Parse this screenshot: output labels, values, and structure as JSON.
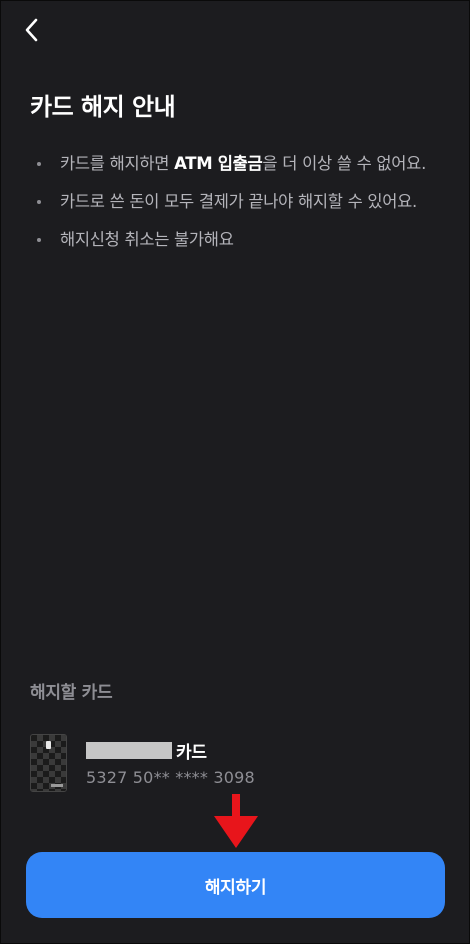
{
  "nav": {
    "back_icon": "chevron-left-icon"
  },
  "page": {
    "title": "카드 해지 안내"
  },
  "notices": [
    {
      "before": "카드를 해지하면 ",
      "emphasis": "ATM 입출금",
      "after": "을 더 이상 쓸 수 없어요."
    },
    {
      "before": "카드로 쓴 돈이 모두 결제가 끝나야 해지할 수 있어요.",
      "emphasis": "",
      "after": ""
    },
    {
      "before": "해지신청 취소는 불가해요",
      "emphasis": "",
      "after": ""
    }
  ],
  "card_section": {
    "label": "해지할 카드",
    "card": {
      "name_suffix": "카드",
      "number": "5327 50** **** 3098"
    }
  },
  "actions": {
    "cancel_card_label": "해지하기"
  },
  "colors": {
    "background": "#1c1c1f",
    "primary": "#3385f6",
    "annotation_arrow": "#e8151b",
    "muted_text": "#8e8e94",
    "body_text": "#b4b4ba"
  }
}
